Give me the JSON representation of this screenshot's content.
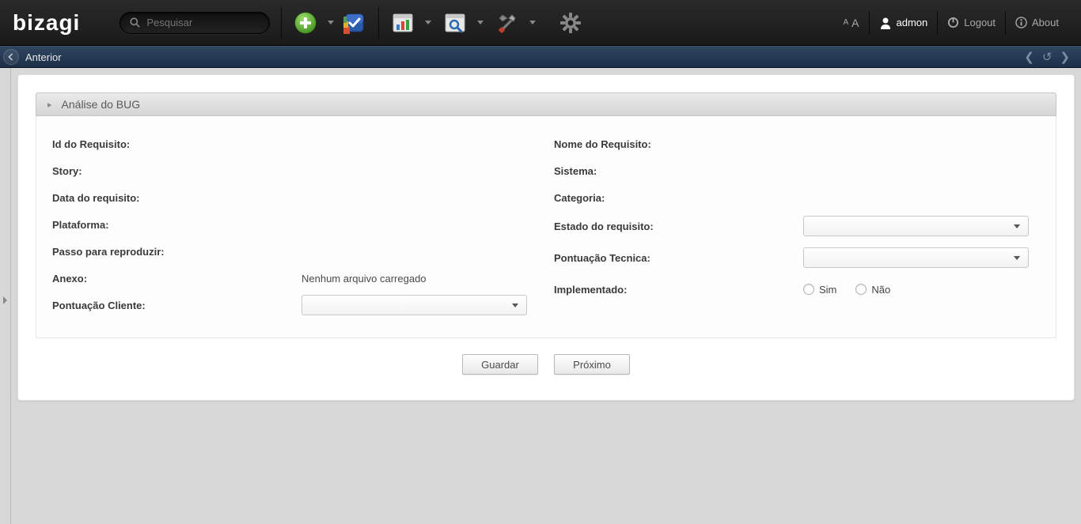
{
  "header": {
    "logo": "bizagi",
    "search_placeholder": "Pesquisar",
    "user_label": "admon",
    "logout_label": "Logout",
    "about_label": "About",
    "font_label": "AA"
  },
  "breadcrumb": {
    "back_label": "Anterior"
  },
  "section": {
    "title": "Análise do BUG"
  },
  "left_fields": {
    "id_requisito": "Id do Requisito:",
    "story": "Story:",
    "data_requisito": "Data do requisito:",
    "plataforma": "Plataforma:",
    "passo_reproduzir": "Passo para reproduzir:",
    "anexo": "Anexo:",
    "anexo_value": "Nenhum arquivo carregado",
    "pontuacao_cliente": "Pontuação Cliente:"
  },
  "right_fields": {
    "nome_requisito": "Nome do Requisito:",
    "sistema": "Sistema:",
    "categoria": "Categoria:",
    "estado_requisito": "Estado do requisito:",
    "pontuacao_tecnica": "Pontuação Tecnica:",
    "implementado": "Implementado:",
    "radio_sim": "Sim",
    "radio_nao": "Não"
  },
  "buttons": {
    "save": "Guardar",
    "next": "Próximo"
  }
}
